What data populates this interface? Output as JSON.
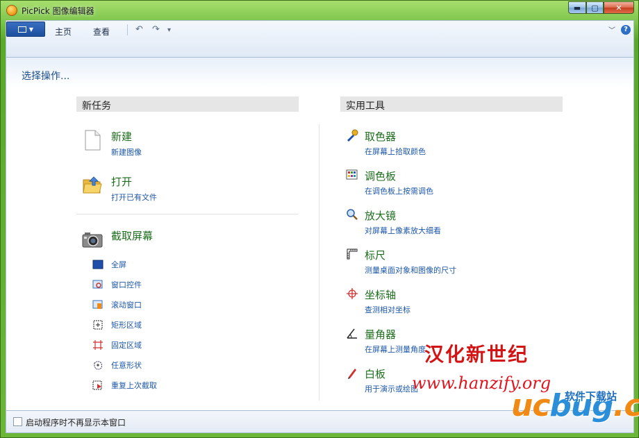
{
  "window": {
    "title": "PicPick 图像编辑器",
    "controls": {
      "minimize": "▬",
      "maximize": "▢",
      "close": "✕"
    }
  },
  "ribbon": {
    "tabs": [
      {
        "label": "主页"
      },
      {
        "label": "查看"
      }
    ],
    "quick_access": {
      "undo": "↶",
      "redo": "↷",
      "more": "▾"
    },
    "collapse": "﹀",
    "help": "?"
  },
  "main": {
    "heading": "选择操作...",
    "new_task": {
      "header": "新任务",
      "items": [
        {
          "label": "新建",
          "sub": "新建图像",
          "icon": "blank-page-icon"
        },
        {
          "label": "打开",
          "sub": "打开已有文件",
          "icon": "folder-icon"
        }
      ],
      "capture": {
        "label": "截取屏幕",
        "icon": "camera-icon",
        "options": [
          {
            "label": "全屏",
            "icon": "fullscreen-icon"
          },
          {
            "label": "窗口控件",
            "icon": "window-control-icon"
          },
          {
            "label": "滚动窗口",
            "icon": "scroll-window-icon"
          },
          {
            "label": "矩形区域",
            "icon": "rect-region-icon"
          },
          {
            "label": "固定区域",
            "icon": "fixed-region-icon"
          },
          {
            "label": "任意形状",
            "icon": "freehand-icon"
          },
          {
            "label": "重复上次截取",
            "icon": "repeat-capture-icon"
          }
        ]
      }
    },
    "tools": {
      "header": "实用工具",
      "items": [
        {
          "label": "取色器",
          "sub": "在屏幕上拾取颜色",
          "icon": "color-picker-icon"
        },
        {
          "label": "调色板",
          "sub": "在调色板上按需调色",
          "icon": "palette-icon"
        },
        {
          "label": "放大镜",
          "sub": "对屏幕上像素放大细看",
          "icon": "magnifier-icon"
        },
        {
          "label": "标尺",
          "sub": "测量桌面对象和图像的尺寸",
          "icon": "ruler-icon"
        },
        {
          "label": "坐标轴",
          "sub": "查测相对坐标",
          "icon": "crosshair-icon"
        },
        {
          "label": "量角器",
          "sub": "在屏幕上测量角度",
          "icon": "protractor-icon"
        },
        {
          "label": "白板",
          "sub": "用于演示或绘图",
          "icon": "whiteboard-icon"
        }
      ]
    }
  },
  "footer": {
    "checkbox_label": "启动程序时不再显示本窗口",
    "checked": false
  },
  "watermarks": {
    "cn": "汉化新世纪",
    "url": "www.hanzify.org",
    "ucbug_uc": "uc",
    "ucbug_bug": "bug",
    "ucbug_cc": ".cc",
    "soft": "软件下载站"
  }
}
